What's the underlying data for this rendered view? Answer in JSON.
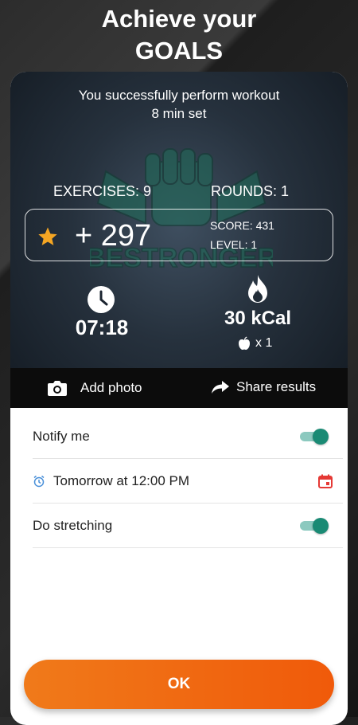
{
  "hero": {
    "line1": "Achieve your",
    "line2": "GOALS"
  },
  "result": {
    "message_line1": "You successfully perform workout",
    "message_line2": "8 min set",
    "exercises": "EXERCISES: 9",
    "rounds": "ROUNDS: 1",
    "points": "+ 297",
    "score": "SCORE: 431",
    "level": "LEVEL: 1",
    "time": "07:18",
    "calories": "30 kCal",
    "apples": "x 1",
    "logo_text": "BESTRONGER"
  },
  "actions": {
    "add_photo": "Add photo",
    "share": "Share results"
  },
  "settings": {
    "notify_label": "Notify me",
    "notify_on": true,
    "reminder_label": "Tomorrow at 12:00 PM",
    "stretching_label": "Do stretching",
    "stretching_on": true
  },
  "ok_button": "OK",
  "colors": {
    "accent_orange": "#f06a10",
    "toggle_green": "#1a8a74",
    "star": "#f5a623",
    "calendar_red": "#e53935",
    "alarm_blue": "#4a90d9"
  },
  "icons": [
    "star-icon",
    "clock-icon",
    "fire-icon",
    "apple-icon",
    "camera-icon",
    "share-icon",
    "alarm-icon",
    "calendar-icon"
  ]
}
